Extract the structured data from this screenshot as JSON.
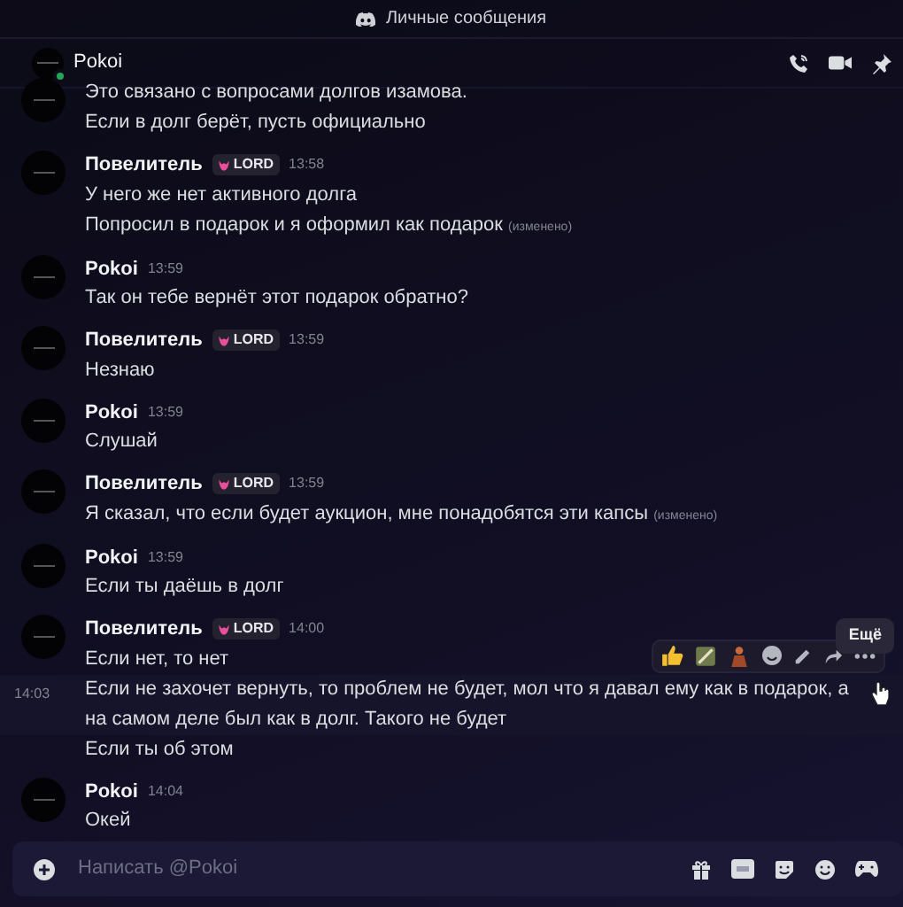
{
  "title_bar": {
    "title": "Личные сообщения"
  },
  "header": {
    "name": "Pokoi",
    "online": true
  },
  "messages": [
    {
      "lines": [
        {
          "text": "Это связано с вопросами долгов изамова.",
          "hovered": false
        },
        {
          "text": "Если в долг берёт, пусть официально",
          "hovered": false
        }
      ]
    },
    {
      "author": "Повелитель",
      "badge": "LORD",
      "time": "13:58",
      "lines": [
        {
          "text": "У него же нет активного долга",
          "hovered": false
        },
        {
          "text": "Попросил в подарок и я оформил как подарок",
          "edited": "(изменено)",
          "hovered": false
        }
      ]
    },
    {
      "author": "Pokoi",
      "time": "13:59",
      "lines": [
        {
          "text": "Так он тебе вернёт этот подарок обратно?",
          "hovered": false
        }
      ]
    },
    {
      "author": "Повелитель",
      "badge": "LORD",
      "time": "13:59",
      "lines": [
        {
          "text": "Незнаю",
          "hovered": false
        }
      ]
    },
    {
      "author": "Pokoi",
      "time": "13:59",
      "lines": [
        {
          "text": "Слушай",
          "hovered": false
        }
      ]
    },
    {
      "author": "Повелитель",
      "badge": "LORD",
      "time": "13:59",
      "lines": [
        {
          "text": "Я сказал, что если будет аукцион, мне понадобятся эти капсы",
          "edited": "(изменено)",
          "hovered": false
        }
      ]
    },
    {
      "author": "Pokoi",
      "time": "13:59",
      "lines": [
        {
          "text": "Если ты даёшь в долг",
          "hovered": false
        }
      ]
    },
    {
      "author": "Повелитель",
      "badge": "LORD",
      "time": "14:00",
      "lines": [
        {
          "text": "Если нет, то нет",
          "hovered": false
        },
        {
          "text": "Если не захочет вернуть, то проблем не будет, мол что я давал ему как в подарок, а на самом деле был как в долг. Такого не будет",
          "timestamp": "14:03",
          "hovered": true
        },
        {
          "text": "Если ты об этом",
          "hovered": false
        }
      ]
    },
    {
      "author": "Pokoi",
      "time": "14:04",
      "lines": [
        {
          "text": "Окей",
          "hovered": false
        }
      ]
    }
  ],
  "tooltip": "Ещё",
  "composer": {
    "placeholder": "Написать @Pokoi"
  }
}
